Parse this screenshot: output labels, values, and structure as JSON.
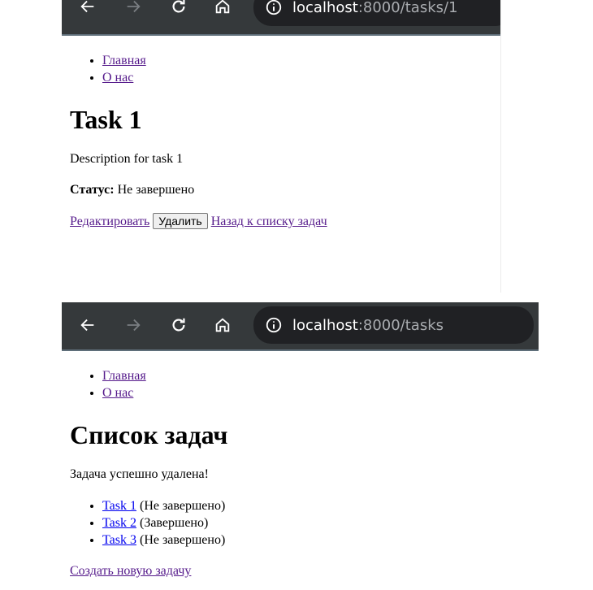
{
  "browser_top": {
    "url_host": "localhost",
    "url_rest": ":8000/tasks/1"
  },
  "page_top": {
    "nav": [
      "Главная",
      "О нас"
    ],
    "title": "Task 1",
    "description": "Description for task 1",
    "status_label": "Статус:",
    "status_value": " Не завершено",
    "edit_link": "Редактировать",
    "delete_button": "Удалить",
    "back_link": "Назад к списку задач"
  },
  "browser_bottom": {
    "url_host": "localhost",
    "url_rest": ":8000/tasks"
  },
  "page_bottom": {
    "nav": [
      "Главная",
      "О нас"
    ],
    "title": "Список задач",
    "flash": "Задача успешно удалена!",
    "tasks": [
      {
        "link": "Task 1",
        "status": " (Не завершено)"
      },
      {
        "link": "Task 2",
        "status": " (Завершено)"
      },
      {
        "link": "Task 3",
        "status": " (Не завершено)"
      }
    ],
    "create_link": "Создать новую задачу"
  },
  "colors": {
    "toolbar_bg": "#35393b",
    "omnibox_bg": "#202124",
    "visited_link": "#551a8b",
    "link": "#0000ee"
  }
}
